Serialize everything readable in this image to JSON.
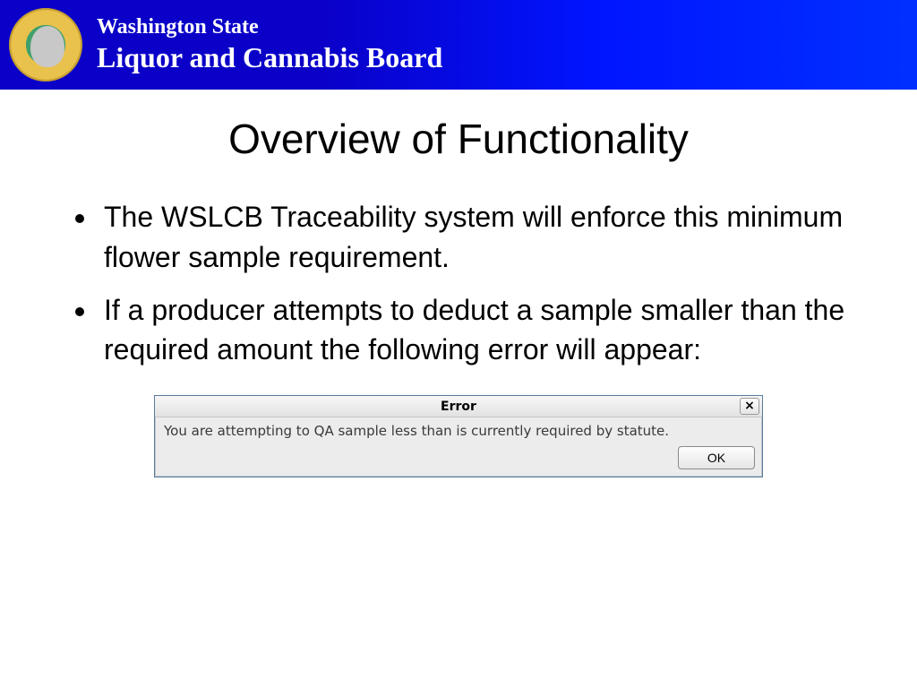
{
  "header": {
    "line1": "Washington State",
    "line2": "Liquor and Cannabis Board"
  },
  "title": "Overview of Functionality",
  "bullets": [
    "The WSLCB Traceability system will enforce this minimum flower sample requirement.",
    "If a producer attempts to deduct a sample smaller than the required amount the following error will appear:"
  ],
  "errorDialog": {
    "title": "Error",
    "message": "You are attempting to QA sample less than is currently required by statute.",
    "okLabel": "OK",
    "closeLabel": "×"
  }
}
